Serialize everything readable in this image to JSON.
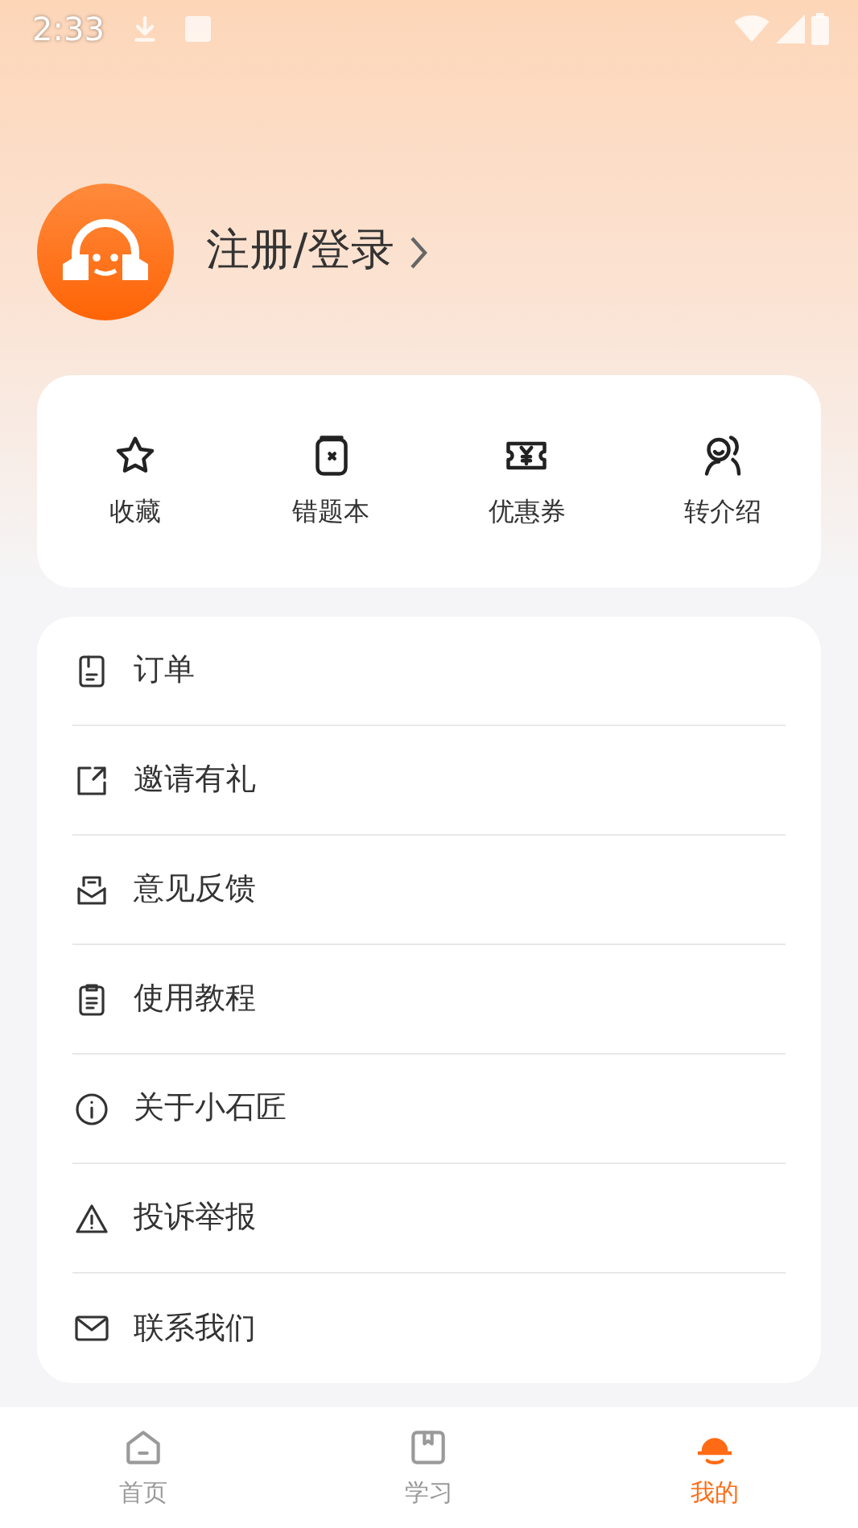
{
  "status_bar": {
    "time": "2:33"
  },
  "profile": {
    "login_label": "注册/登录"
  },
  "shortcuts": [
    {
      "kind": "star",
      "label": "收藏"
    },
    {
      "kind": "notebook",
      "label": "错题本"
    },
    {
      "kind": "coupon",
      "label": "优惠券"
    },
    {
      "kind": "referral",
      "label": "转介绍"
    }
  ],
  "menu": [
    {
      "kind": "order",
      "label": "订单"
    },
    {
      "kind": "share",
      "label": "邀请有礼"
    },
    {
      "kind": "feedback",
      "label": "意见反馈"
    },
    {
      "kind": "guide",
      "label": "使用教程"
    },
    {
      "kind": "info",
      "label": "关于小石匠"
    },
    {
      "kind": "warning",
      "label": "投诉举报"
    },
    {
      "kind": "mail",
      "label": "联系我们"
    }
  ],
  "tabs": [
    {
      "kind": "home",
      "label": "首页",
      "selected": false
    },
    {
      "kind": "study",
      "label": "学习",
      "selected": false
    },
    {
      "kind": "me",
      "label": "我的",
      "selected": true
    }
  ]
}
